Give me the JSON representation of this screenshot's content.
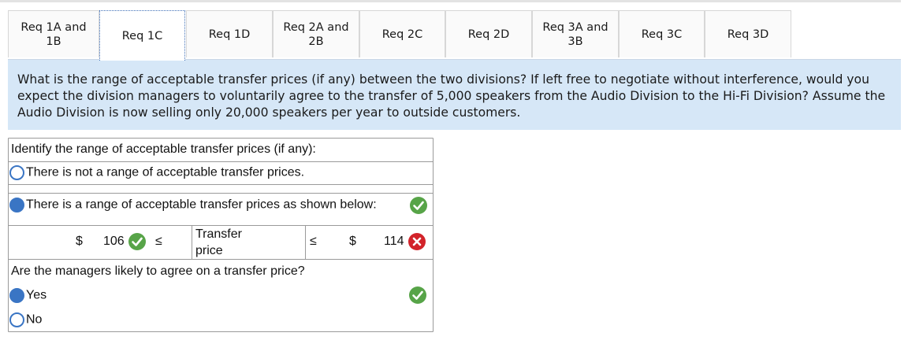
{
  "tabs": [
    {
      "label": "Req 1A and\n1B",
      "active": false
    },
    {
      "label": "Req 1C",
      "active": true
    },
    {
      "label": "Req 1D",
      "active": false
    },
    {
      "label": "Req 2A and\n2B",
      "active": false
    },
    {
      "label": "Req 2C",
      "active": false
    },
    {
      "label": "Req 2D",
      "active": false
    },
    {
      "label": "Req 3A and\n3B",
      "active": false
    },
    {
      "label": "Req 3C",
      "active": false
    },
    {
      "label": "Req 3D",
      "active": false
    }
  ],
  "question": "What is the range of acceptable transfer prices (if any) between the two divisions? If left free to negotiate without interference, would you expect the division managers to voluntarily agree to the transfer of 5,000 speakers from the Audio Division to the Hi-Fi Division? Assume the Audio Division is now selling only 20,000 speakers per year to outside customers.",
  "range": {
    "heading": "Identify the range of acceptable transfer prices (if any):",
    "option_none": "There is not a range of acceptable transfer prices.",
    "option_range": "There is a range of acceptable transfer prices as shown below:",
    "selected": "option_range",
    "currency": "$",
    "low_value": "106",
    "le_symbol": "≤",
    "middle_label": "Transfer\nprice",
    "high_value": "114",
    "low_status": "correct",
    "high_status": "incorrect",
    "option_status": "correct"
  },
  "agree": {
    "question": "Are the managers likely to agree on a transfer price?",
    "options": [
      "Yes",
      "No"
    ],
    "selected": "Yes",
    "status": "correct"
  },
  "colors": {
    "radio_blue": "#3a75c4",
    "check_green": "#57a448",
    "x_red": "#d2232a",
    "question_bg": "#d6e7f7"
  },
  "icons": {
    "correct": "check-circle-icon",
    "incorrect": "x-circle-icon"
  }
}
